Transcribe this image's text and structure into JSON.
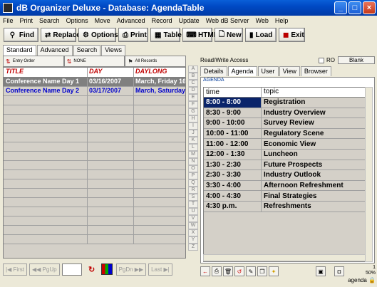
{
  "window": {
    "title": "dB Organizer Deluxe - Database: AgendaTable"
  },
  "menu": [
    "File",
    "Print",
    "Search",
    "Options",
    "Move",
    "Advanced",
    "Record",
    "Update",
    "Web dB Server",
    "Web",
    "Help"
  ],
  "toolbar": [
    {
      "label": "Find",
      "icon": "search-icon"
    },
    {
      "label": "Replace",
      "icon": "replace-icon"
    },
    {
      "label": "Options",
      "icon": "options-icon"
    },
    {
      "label": "Print",
      "icon": "printer-icon"
    },
    {
      "label": "Table",
      "icon": "table-icon"
    },
    {
      "label": "HTML",
      "icon": "html-icon"
    },
    {
      "label": "New",
      "icon": "new-document-icon"
    },
    {
      "label": "Load",
      "icon": "load-icon"
    },
    {
      "label": "Exit",
      "icon": "exit-icon"
    }
  ],
  "view_tabs": [
    "Standard",
    "Advanced",
    "Search",
    "Views"
  ],
  "sort": {
    "entry_order": "Entry Order",
    "none": "NONE",
    "all_records": "All Records"
  },
  "records": {
    "columns": [
      "TITLE",
      "DAY",
      "DAYLONG"
    ],
    "rows": [
      {
        "title": "Conference Name Day 1",
        "day": "03/16/2007",
        "daylong": "March, Friday 16"
      },
      {
        "title": "Conference Name Day 2",
        "day": "03/17/2007",
        "daylong": "March, Saturday"
      }
    ]
  },
  "nav": {
    "first": "First",
    "pgup": "PgUp",
    "pgdn": "PgDn",
    "last": "Last"
  },
  "alphabet": [
    "A",
    "B",
    "C",
    "D",
    "E",
    "F",
    "G",
    "H",
    "I",
    "J",
    "K",
    "L",
    "M",
    "N",
    "O",
    "P",
    "Q",
    "R",
    "S",
    "T",
    "U",
    "V",
    "W",
    "X",
    "Y",
    "Z"
  ],
  "access": {
    "text": "Read/Write Access",
    "ro": "RO",
    "blank": "Blank"
  },
  "detail_tabs": [
    "Details",
    "Agenda",
    "User",
    "View",
    "Browser"
  ],
  "agenda": {
    "label": "AGENDA",
    "columns": [
      "time",
      "topic"
    ],
    "rows": [
      {
        "time": "8:00 - 8:00",
        "topic": "Registration"
      },
      {
        "time": "8:30 - 9:00",
        "topic": "Industry Overview"
      },
      {
        "time": "9:00 - 10:00",
        "topic": "Survey Review"
      },
      {
        "time": "10:00 - 11:00",
        "topic": "Regulatory Scene"
      },
      {
        "time": "11:00 - 12:00",
        "topic": "Economic View"
      },
      {
        "time": "12:00 - 1:30",
        "topic": "Luncheon"
      },
      {
        "time": "1:30 - 2:30",
        "topic": "Future Prospects"
      },
      {
        "time": "2:30 - 3:30",
        "topic": "Industry Outlook"
      },
      {
        "time": "3:30 - 4:00",
        "topic": "Afternoon Refreshment"
      },
      {
        "time": "4:00 - 4:30",
        "topic": "Final Strategies"
      },
      {
        "time": "4:30 p.m.",
        "topic": "Refreshments"
      }
    ]
  },
  "status": {
    "record": "1",
    "zoom": "50%",
    "table": "agenda"
  }
}
